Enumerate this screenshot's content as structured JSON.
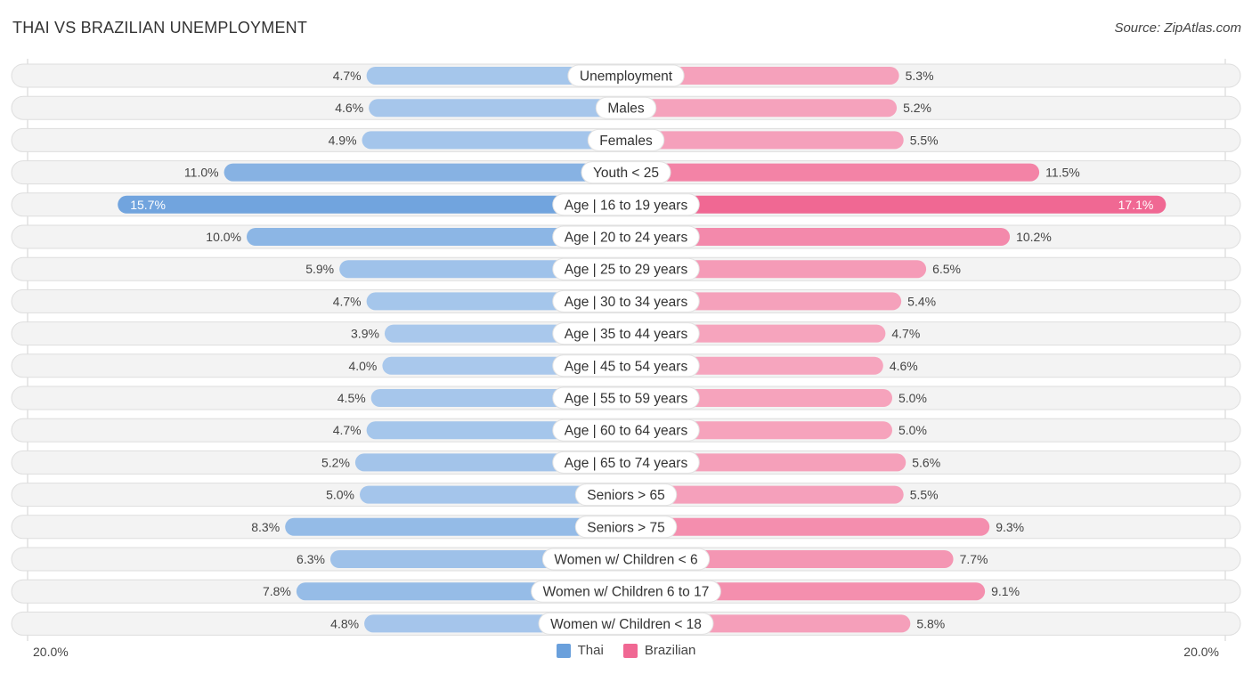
{
  "header": {
    "title": "THAI VS BRAZILIAN UNEMPLOYMENT",
    "source": "Source: ZipAtlas.com"
  },
  "colors": {
    "thai": "#6aa0dc",
    "thai_light": "#a9c8ec",
    "brazilian": "#f06893",
    "brazilian_light": "#f6a8c0",
    "row_bg": "#f3f3f3"
  },
  "legend": {
    "thai_label": "Thai",
    "brazilian_label": "Brazilian"
  },
  "axis": {
    "left_label": "20.0%",
    "right_label": "20.0%"
  },
  "chart_data": {
    "type": "bar",
    "orientation": "diverging-horizontal",
    "title": "THAI VS BRAZILIAN UNEMPLOYMENT",
    "xlabel": "",
    "ylabel": "",
    "xlim": [
      0,
      20
    ],
    "legend_position": "bottom-center",
    "categories": [
      "Unemployment",
      "Males",
      "Females",
      "Youth < 25",
      "Age | 16 to 19 years",
      "Age | 20 to 24 years",
      "Age | 25 to 29 years",
      "Age | 30 to 34 years",
      "Age | 35 to 44 years",
      "Age | 45 to 54 years",
      "Age | 55 to 59 years",
      "Age | 60 to 64 years",
      "Age | 65 to 74 years",
      "Seniors > 65",
      "Seniors > 75",
      "Women w/ Children < 6",
      "Women w/ Children 6 to 17",
      "Women w/ Children < 18"
    ],
    "series": [
      {
        "name": "Thai",
        "side": "left",
        "values": [
          4.7,
          4.6,
          4.9,
          11.0,
          15.7,
          10.0,
          5.9,
          4.7,
          3.9,
          4.0,
          4.5,
          4.7,
          5.2,
          5.0,
          8.3,
          6.3,
          7.8,
          4.8
        ],
        "labels": [
          "4.7%",
          "4.6%",
          "4.9%",
          "11.0%",
          "15.7%",
          "10.0%",
          "5.9%",
          "4.7%",
          "3.9%",
          "4.0%",
          "4.5%",
          "4.7%",
          "5.2%",
          "5.0%",
          "8.3%",
          "6.3%",
          "7.8%",
          "4.8%"
        ]
      },
      {
        "name": "Brazilian",
        "side": "right",
        "values": [
          5.3,
          5.2,
          5.5,
          11.5,
          17.1,
          10.2,
          6.5,
          5.4,
          4.7,
          4.6,
          5.0,
          5.0,
          5.6,
          5.5,
          9.3,
          7.7,
          9.1,
          5.8
        ],
        "labels": [
          "5.3%",
          "5.2%",
          "5.5%",
          "11.5%",
          "17.1%",
          "10.2%",
          "6.5%",
          "5.4%",
          "4.7%",
          "4.6%",
          "5.0%",
          "5.0%",
          "5.6%",
          "5.5%",
          "9.3%",
          "7.7%",
          "9.1%",
          "5.8%"
        ]
      }
    ]
  }
}
